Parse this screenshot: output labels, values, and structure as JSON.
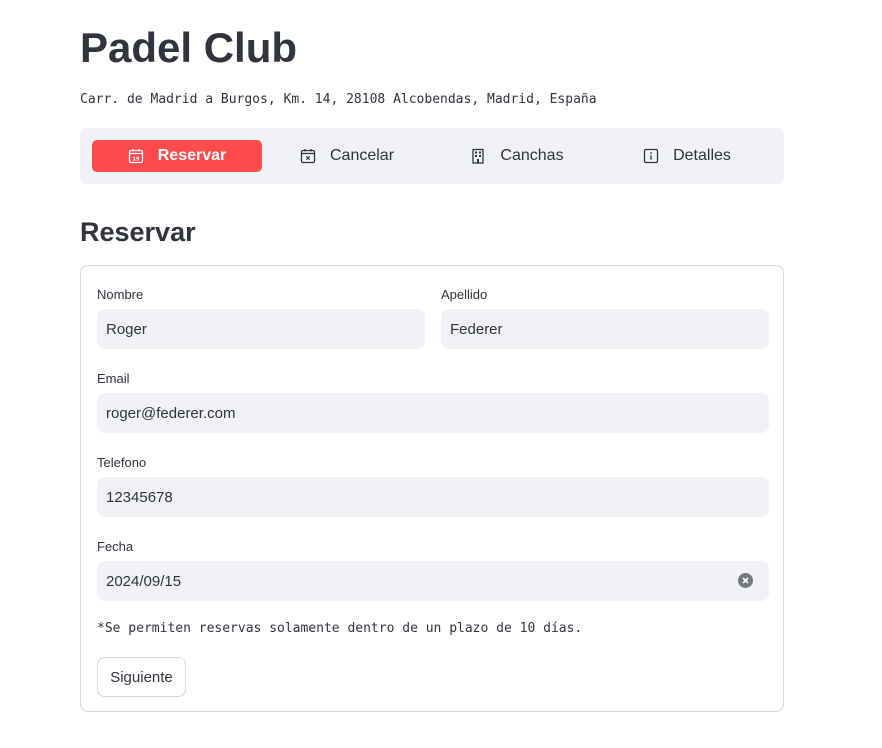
{
  "header": {
    "title": "Padel Club",
    "address": "Carr. de Madrid a Burgos, Km. 14, 28108 Alcobendas, Madrid, España"
  },
  "nav": {
    "items": [
      {
        "label": "Reservar",
        "icon": "calendar-icon",
        "active": true
      },
      {
        "label": "Cancelar",
        "icon": "calendar-x-icon",
        "active": false
      },
      {
        "label": "Canchas",
        "icon": "building-icon",
        "active": false
      },
      {
        "label": "Detalles",
        "icon": "info-icon",
        "active": false
      }
    ],
    "active_color": "#ff4b4b",
    "background": "#f0f2f6"
  },
  "section": {
    "title": "Reservar"
  },
  "form": {
    "nombre": {
      "label": "Nombre",
      "value": "Roger"
    },
    "apellido": {
      "label": "Apellido",
      "value": "Federer"
    },
    "email": {
      "label": "Email",
      "value": "roger@federer.com"
    },
    "telefono": {
      "label": "Telefono",
      "value": "12345678"
    },
    "fecha": {
      "label": "Fecha",
      "value": "2024/09/15",
      "icon": "clear-icon"
    },
    "note": "*Se permiten reservas solamente dentro de un plazo de 10 días.",
    "next_label": "Siguiente"
  }
}
